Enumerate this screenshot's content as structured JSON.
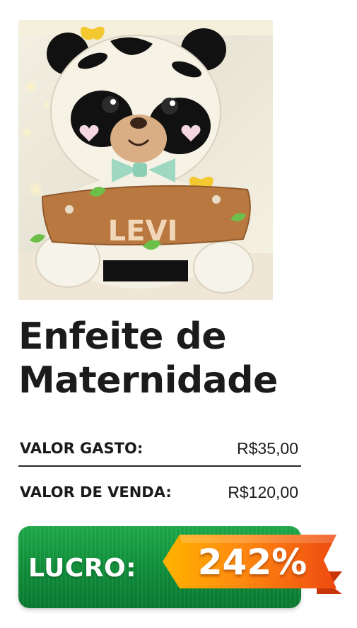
{
  "product": {
    "title_line1": "Enfeite de",
    "title_line2": "Maternidade",
    "photo_name_text": "LEVI"
  },
  "pricing": {
    "cost_label": "VALOR GASTO:",
    "cost_value": "R$35,00",
    "sale_label": "VALOR DE VENDA:",
    "sale_value": "R$120,00"
  },
  "profit": {
    "label": "LUCRO:",
    "percent": "242%"
  },
  "colors": {
    "banner_green": "#119340",
    "ribbon_orange": "#f26b12",
    "ribbon_yellow": "#ffb000",
    "title_text": "#1b1b1b"
  }
}
